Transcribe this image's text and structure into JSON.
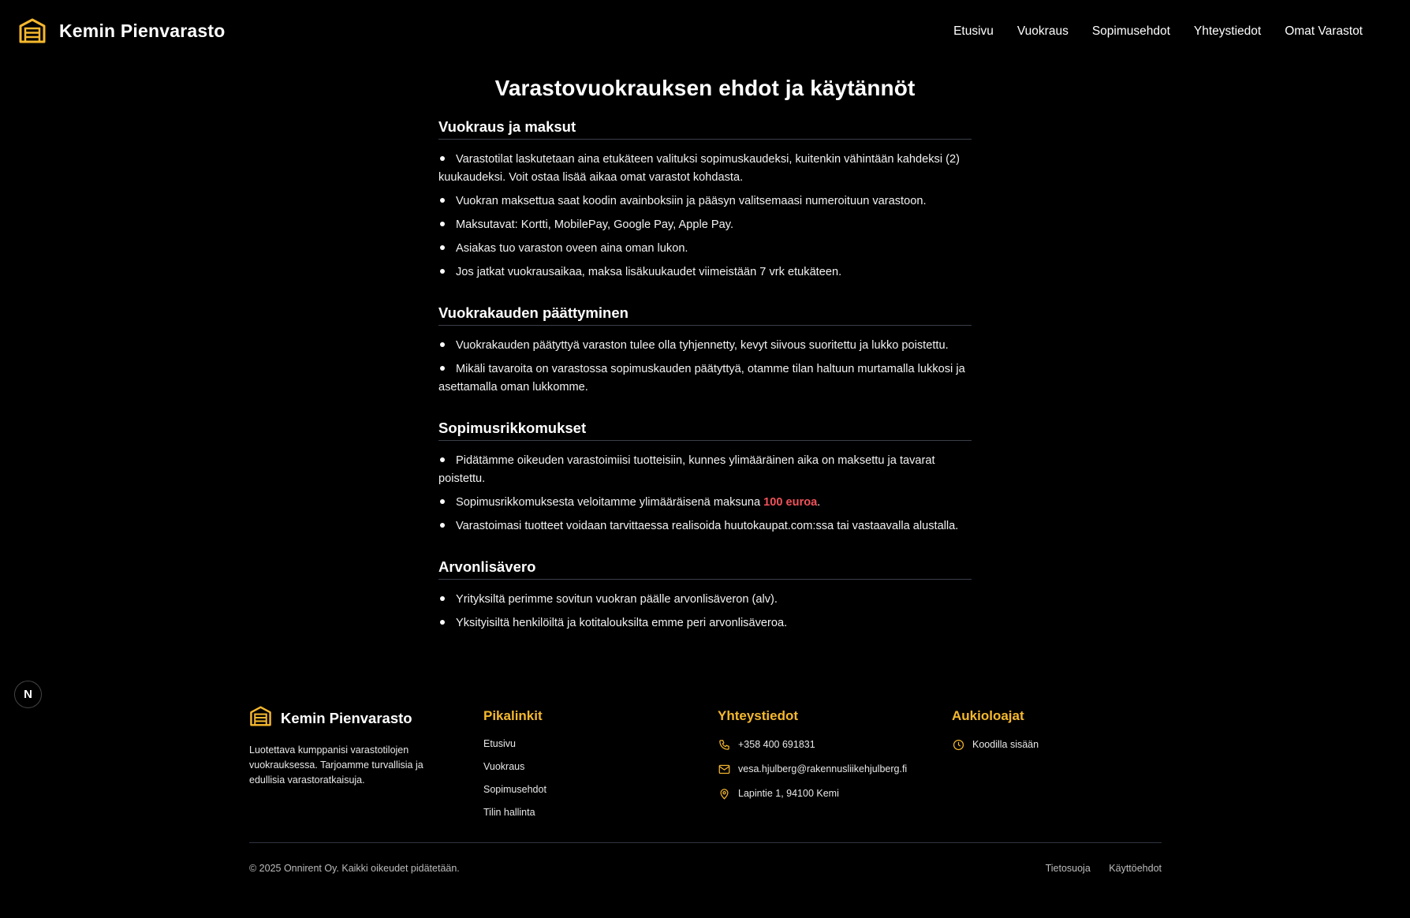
{
  "header": {
    "brand": "Kemin Pienvarasto",
    "nav": [
      "Etusivu",
      "Vuokraus",
      "Sopimusehdot",
      "Yhteystiedot",
      "Omat Varastot"
    ]
  },
  "main": {
    "title": "Varastovuokrauksen ehdot ja käytännöt",
    "sections": [
      {
        "heading": "Vuokraus ja maksut",
        "items": [
          "Varastotilat laskutetaan aina etukäteen valituksi sopimuskaudeksi, kuitenkin vähintään kahdeksi (2) kuukaudeksi. Voit ostaa lisää aikaa omat varastot kohdasta.",
          "Vuokran maksettua saat koodin avainboksiin ja pääsyn valitsemaasi numeroituun varastoon.",
          "Maksutavat: Kortti, MobilePay, Google Pay, Apple Pay.",
          "Asiakas tuo varaston oveen aina oman lukon.",
          "Jos jatkat vuokrausaikaa, maksa lisäkuukaudet viimeistään 7 vrk etukäteen."
        ]
      },
      {
        "heading": "Vuokrakauden päättyminen",
        "items": [
          "Vuokrakauden päätyttyä varaston tulee olla tyhjennetty, kevyt siivous suoritettu ja lukko poistettu.",
          "Mikäli tavaroita on varastossa sopimuskauden päätyttyä, otamme tilan haltuun murtamalla lukkosi ja asettamalla oman lukkomme."
        ]
      },
      {
        "heading": "Sopimusrikkomukset",
        "items": [
          "Pidätämme oikeuden varastoimiisi tuotteisiin, kunnes ylimääräinen aika on maksettu ja tavarat poistettu.",
          "Sopimusrikkomuksesta veloitamme ylimääräisenä maksuna",
          "Varastoimasi tuotteet voidaan tarvittaessa realisoida huutokaupat.com:ssa tai vastaavalla alustalla."
        ],
        "fee_amount": "100 euroa",
        "fee_end": "."
      },
      {
        "heading": "Arvonlisävero",
        "items": [
          "Yrityksiltä perimme sovitun vuokran päälle arvonlisäveron (alv).",
          "Yksityisiltä henkilöiltä ja kotitalouksilta emme peri arvonlisäveroa."
        ]
      }
    ]
  },
  "badge": "N",
  "footer": {
    "brand": "Kemin Pienvarasto",
    "description": "Luotettava kumppanisi varastotilojen vuokrauksessa. Tarjoamme turvallisia ja edullisia varastoratkaisuja.",
    "quicklinks": {
      "heading": "Pikalinkit",
      "links": [
        "Etusivu",
        "Vuokraus",
        "Sopimusehdot",
        "Tilin hallinta"
      ]
    },
    "contact": {
      "heading": "Yhteystiedot",
      "phone": "+358 400 691831",
      "email": "vesa.hjulberg@rakennusliikehjulberg.fi",
      "address": "Lapintie 1, 94100 Kemi"
    },
    "hours": {
      "heading": "Aukioloajat",
      "text": "Koodilla sisään"
    },
    "copyright": "© 2025 Onnirent Oy. Kaikki oikeudet pidätetään.",
    "legal": [
      "Tietosuoja",
      "Käyttöehdot"
    ]
  },
  "colors": {
    "accent": "#f5b82e",
    "highlight": "#f0525a",
    "background": "#000000"
  },
  "icons": {
    "logo": "garage-icon",
    "phone": "phone-icon",
    "email": "mail-icon",
    "address": "map-pin-icon",
    "hours": "clock-icon"
  }
}
